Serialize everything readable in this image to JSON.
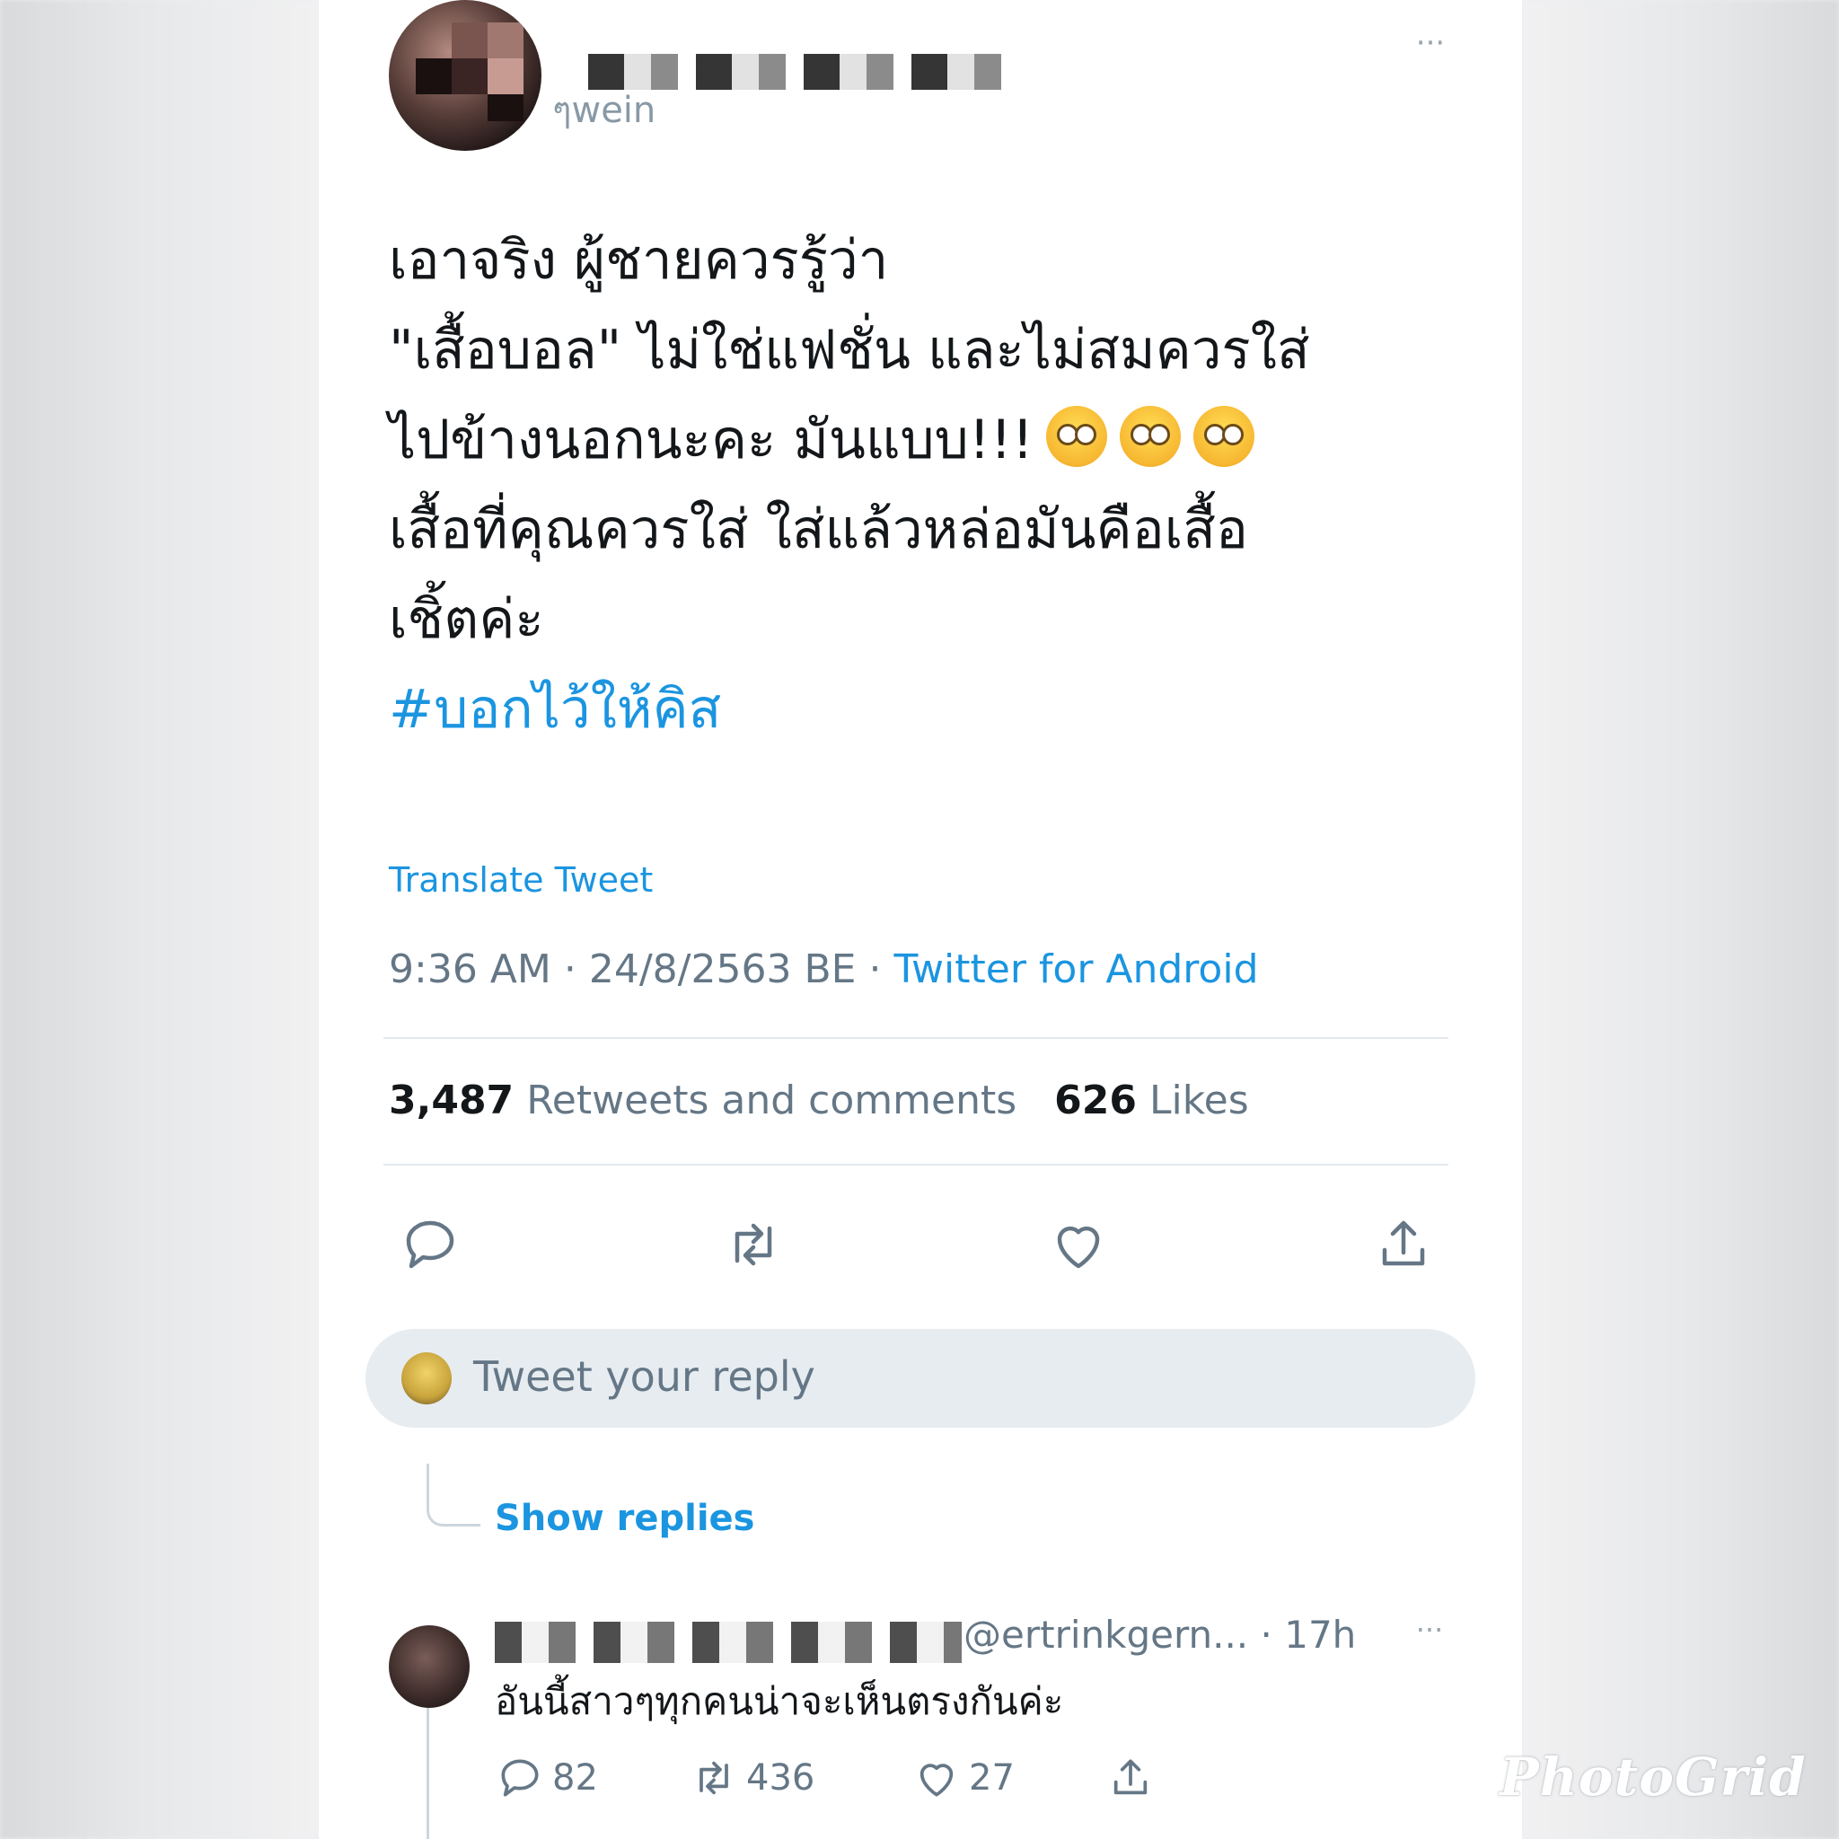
{
  "tweet": {
    "handle_fragment": "ๆwein",
    "more_glyph": "···",
    "lines": [
      "เอาจริง ผู้ชายควรรู้ว่า",
      "\"เสื้อบอล\" ไม่ใช่แฟชั่น และไม่สมควรใส่",
      "ไปข้างนอกนะคะ มันแบบ!!!",
      "เสื้อที่คุณควรใส่ ใส่แล้วหล่อมันคือเสื้อ",
      "เชิ้ตค่ะ"
    ],
    "emojis": [
      "face-with-rolling-eyes",
      "face-with-rolling-eyes",
      "face-with-rolling-eyes"
    ],
    "hashtag": "#บอกไว้ให้คิส",
    "translate_label": "Translate Tweet",
    "time": "9:36 AM",
    "separator": "·",
    "date": "24/8/2563 BE",
    "source": "Twitter for Android"
  },
  "stats": {
    "retweets_count": "3,487",
    "retweets_label": "Retweets and comments",
    "likes_count": "626",
    "likes_label": "Likes"
  },
  "actions": [
    "reply-icon",
    "retweet-icon",
    "like-icon",
    "share-icon"
  ],
  "reply_box": {
    "placeholder": "Tweet your reply"
  },
  "show_replies_label": "Show replies",
  "comment": {
    "handle": "@ertrinkgern...",
    "time": "· 17h",
    "more_glyph": "···",
    "text": "อันนี้สาวๆทุกคนน่าจะเห็นตรงกันค่ะ",
    "replies": "82",
    "retweets": "436",
    "likes": "27"
  },
  "watermark": "PhotoGrid",
  "colors": {
    "link_blue": "#1b95e0",
    "secondary_gray": "#657786",
    "text_dark": "#14171a",
    "divider": "#e1e8ed",
    "reply_box_bg": "#e6ecf0"
  }
}
